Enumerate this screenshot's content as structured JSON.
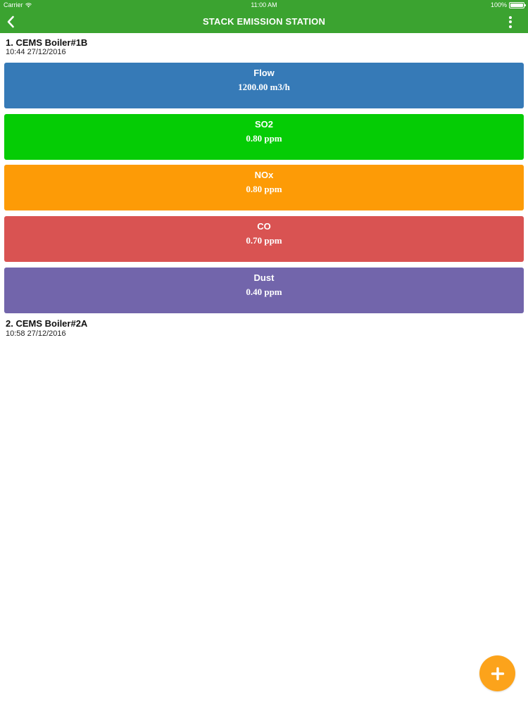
{
  "status_bar": {
    "carrier": "Carrier",
    "time": "11:00 AM",
    "battery": "100%"
  },
  "header": {
    "title": "STACK EMISSION STATION",
    "back_icon": "chevron-left-icon",
    "more_icon": "more-vertical-icon",
    "background_color": "#3ba330"
  },
  "stations": [
    {
      "name": "1. CEMS Boiler#1B",
      "timestamp": "10:44 27/12/2016",
      "metrics": [
        {
          "label": "Flow",
          "value": "1200.00 m3/h",
          "color": "#367ab7"
        },
        {
          "label": "SO2",
          "value": "0.80 ppm",
          "color": "#05cc05"
        },
        {
          "label": "NOx",
          "value": "0.80 ppm",
          "color": "#fd9b06"
        },
        {
          "label": "CO",
          "value": "0.70 ppm",
          "color": "#d95352"
        },
        {
          "label": "Dust",
          "value": "0.40 ppm",
          "color": "#7265ab"
        }
      ]
    },
    {
      "name": "2. CEMS Boiler#2A",
      "timestamp": "10:58 27/12/2016",
      "metrics": []
    }
  ],
  "fab": {
    "icon": "plus-icon",
    "color": "#fca31b"
  }
}
